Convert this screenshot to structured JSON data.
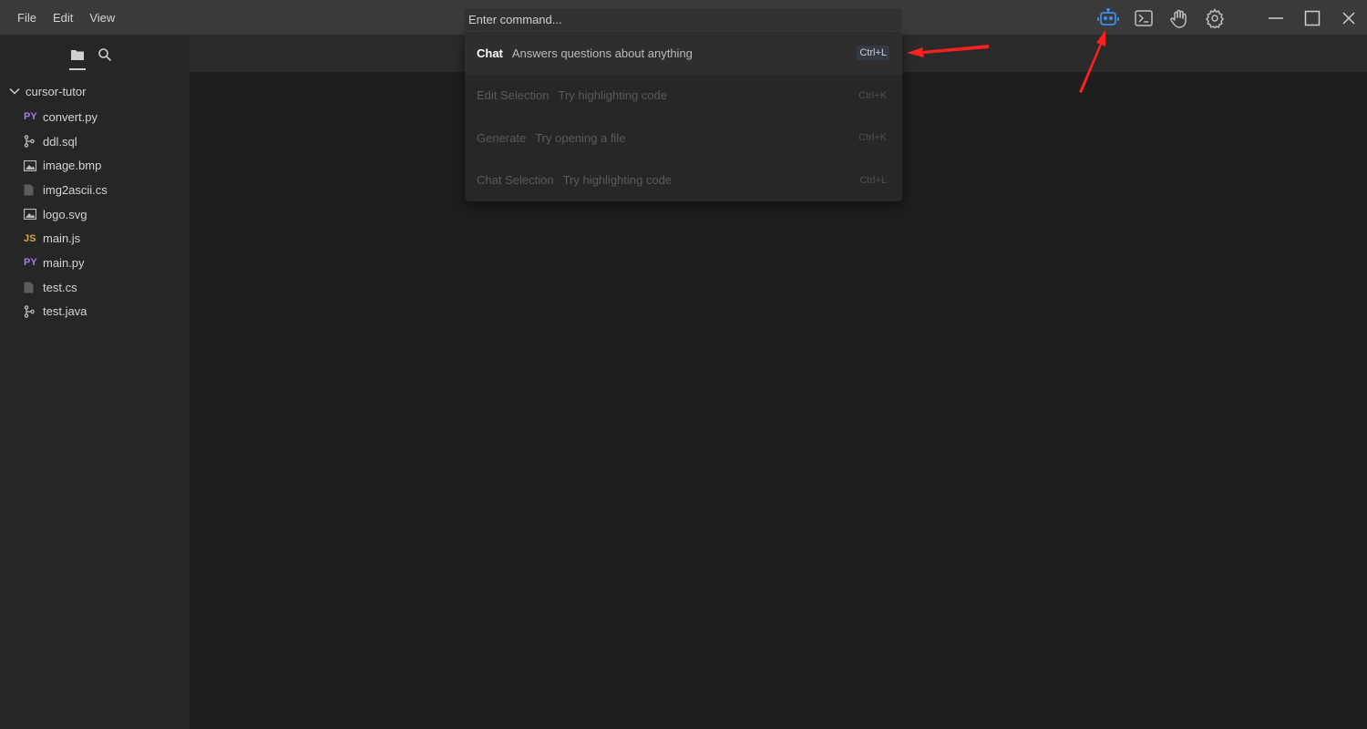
{
  "menu": {
    "items": [
      "File",
      "Edit",
      "View"
    ]
  },
  "command": {
    "placeholder": "Enter command..."
  },
  "toolbar": {
    "icons": [
      "robot-icon",
      "terminal-icon",
      "hand-icon",
      "gear-icon"
    ],
    "accent": "#3b8eea"
  },
  "window_controls": [
    "minimize-icon",
    "maximize-icon",
    "close-icon"
  ],
  "sidebar": {
    "tabs": [
      "folder-icon",
      "search-icon"
    ],
    "root": "cursor-tutor",
    "files": [
      {
        "name": "convert.py",
        "badge": "PY",
        "icon": "python-icon"
      },
      {
        "name": "ddl.sql",
        "badge": "",
        "icon": "git-branch-icon"
      },
      {
        "name": "image.bmp",
        "badge": "",
        "icon": "image-icon"
      },
      {
        "name": "img2ascii.cs",
        "badge": "",
        "icon": "file-icon"
      },
      {
        "name": "logo.svg",
        "badge": "",
        "icon": "image-icon"
      },
      {
        "name": "main.js",
        "badge": "JS",
        "icon": "javascript-icon"
      },
      {
        "name": "main.py",
        "badge": "PY",
        "icon": "python-icon"
      },
      {
        "name": "test.cs",
        "badge": "",
        "icon": "file-icon"
      },
      {
        "name": "test.java",
        "badge": "",
        "icon": "git-branch-icon"
      }
    ]
  },
  "commands": [
    {
      "title": "Chat",
      "desc": "Answers questions about anything",
      "key": "Ctrl+L"
    },
    {
      "title": "Edit Selection",
      "desc": "Try highlighting code",
      "key": "Ctrl+K"
    },
    {
      "title": "Generate",
      "desc": "Try opening a file",
      "key": "Ctrl+K"
    },
    {
      "title": "Chat Selection",
      "desc": "Try highlighting code",
      "key": "Ctrl+L"
    }
  ],
  "colors": {
    "py_badge": "#a27ee0",
    "js_badge": "#d6a54a",
    "annotation": "#ff2020"
  }
}
